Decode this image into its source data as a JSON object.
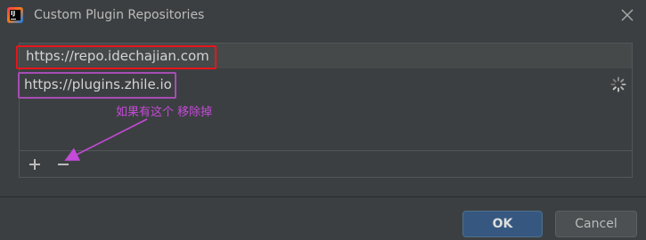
{
  "window": {
    "title": "Custom Plugin Repositories",
    "app_icon": "intellij-idea-icon",
    "app_icon_text": "IJ",
    "close_icon": "close-icon"
  },
  "repositories": [
    {
      "url": "https://repo.idechajian.com",
      "selected": true
    },
    {
      "url": "https://plugins.zhile.io",
      "selected": false
    }
  ],
  "loading_icon": "spinner-icon",
  "annotation": {
    "text": "如果有这个 移除掉",
    "color": "#c34bd8"
  },
  "highlights": {
    "first_row_color": "#e8151b",
    "second_row_color": "#a64db5"
  },
  "toolbar": {
    "add_label": "+",
    "remove_label": "−"
  },
  "buttons": {
    "ok_label": "OK",
    "cancel_label": "Cancel"
  },
  "colors": {
    "background": "#3c3f41",
    "selection": "#45494a",
    "ok_button": "#365880",
    "cancel_button": "#4c5052"
  }
}
